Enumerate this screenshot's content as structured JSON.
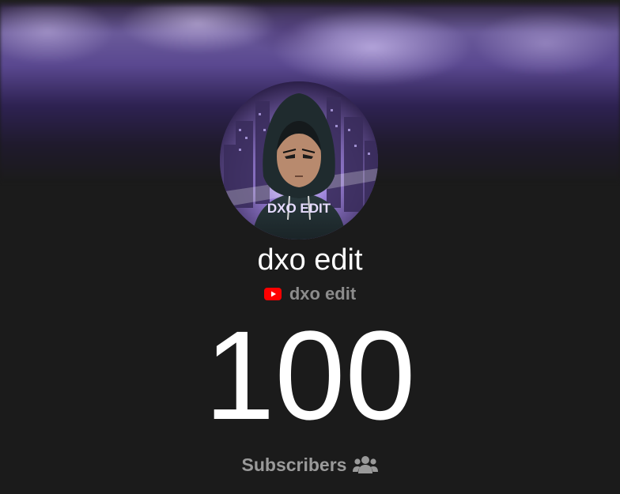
{
  "channel": {
    "name": "dxo edit",
    "handle": "dxo edit",
    "platform_icon": "youtube-icon",
    "avatar_icon": "hooded-figure-avatar",
    "avatar_text": "DXO EDIT"
  },
  "stats": {
    "subscriber_count": "100",
    "subscriber_label": "Subscribers",
    "subscriber_icon": "users-icon"
  },
  "colors": {
    "background": "#1b1b1b",
    "banner_accent": "#6a5a9a",
    "youtube_red": "#ff0000",
    "muted_text": "#8c8c8c"
  }
}
